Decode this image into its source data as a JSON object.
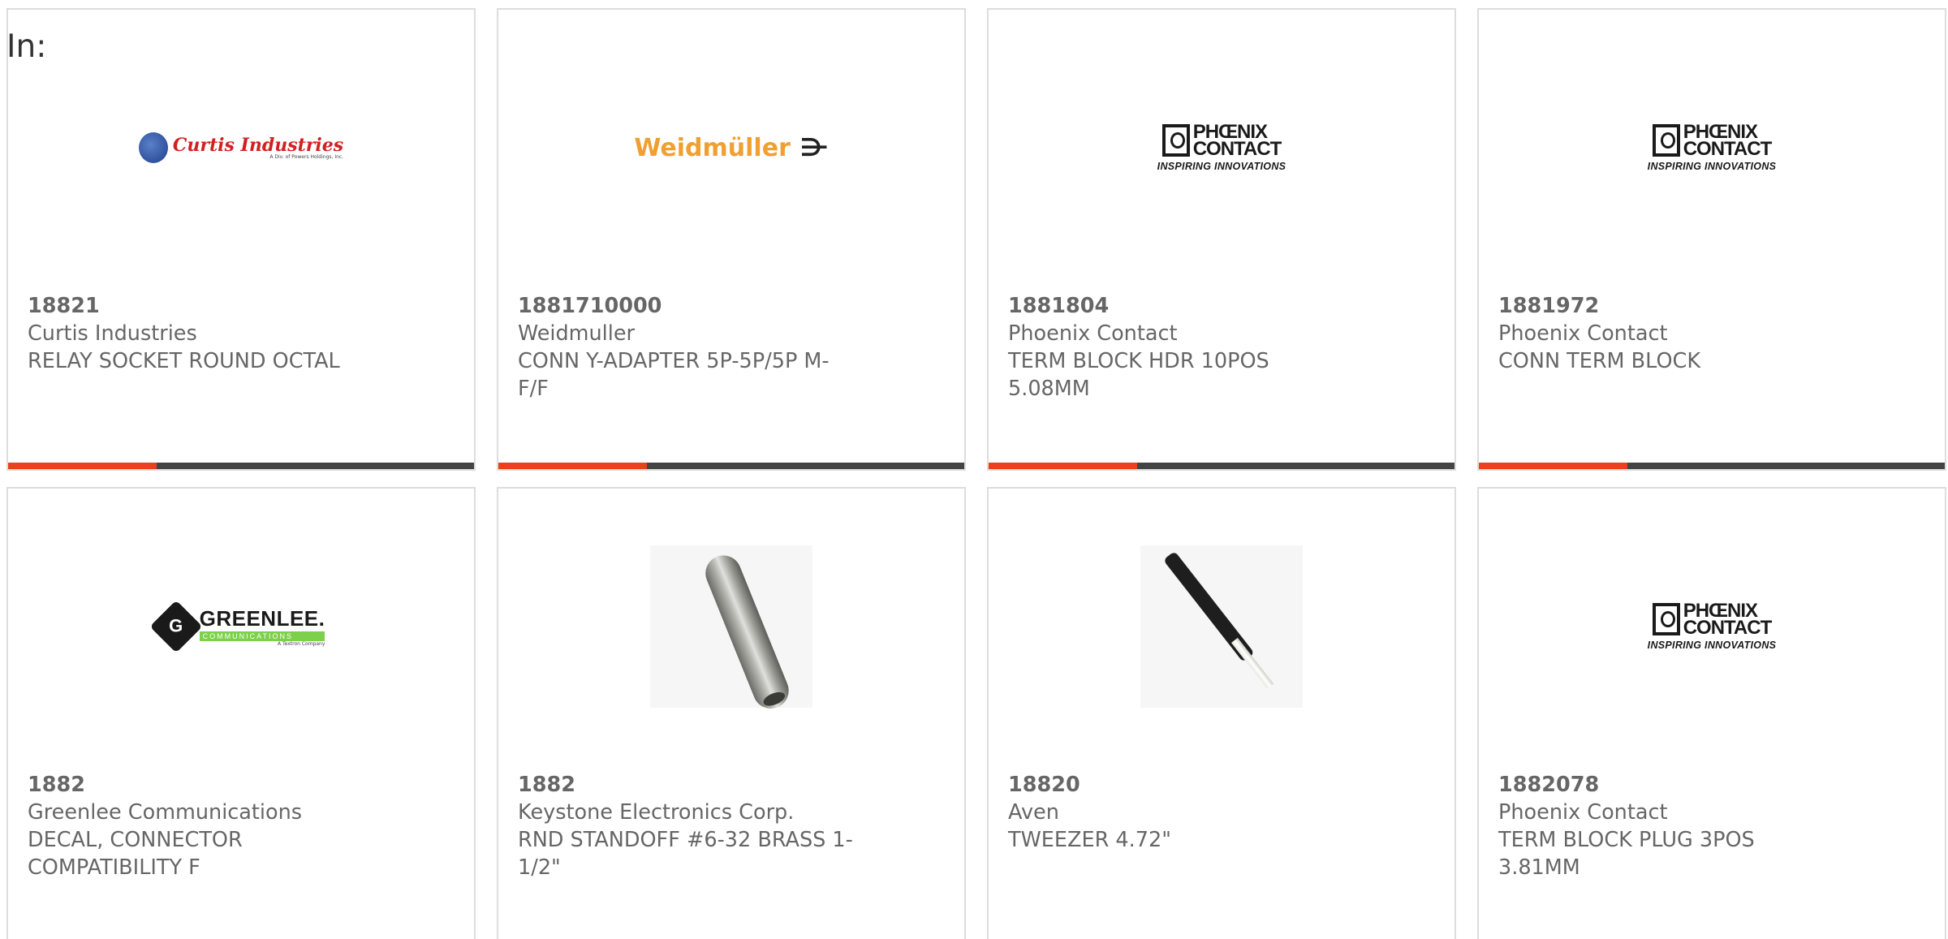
{
  "header": {
    "in_label": "In:"
  },
  "colors": {
    "accent": "#e8411b",
    "bar": "#444444",
    "text": "#666666",
    "border": "#dddddd"
  },
  "products": [
    {
      "logo_name": "Curtis Industries",
      "logo_sub": "A Div. of Powers Holdings, Inc.",
      "part_number": "18821",
      "manufacturer": "Curtis Industries",
      "description": "RELAY SOCKET ROUND OCTAL"
    },
    {
      "logo_name": "Weidmüller",
      "logo_mark": "⋺",
      "part_number": "1881710000",
      "manufacturer": "Weidmuller",
      "description": "CONN Y-ADAPTER 5P-5P/5P M-F/F"
    },
    {
      "logo_line1": "PHŒNIX",
      "logo_line2": "CONTACT",
      "logo_tag": "INSPIRING INNOVATIONS",
      "part_number": "1881804",
      "manufacturer": "Phoenix Contact",
      "description": "TERM BLOCK HDR 10POS 5.08MM"
    },
    {
      "logo_line1": "PHŒNIX",
      "logo_line2": "CONTACT",
      "logo_tag": "INSPIRING INNOVATIONS",
      "part_number": "1881972",
      "manufacturer": "Phoenix Contact",
      "description": "CONN TERM BLOCK"
    },
    {
      "logo_letter": "G",
      "logo_name": "GREENLEE.",
      "logo_sub": "COMMUNICATIONS",
      "logo_tiny": "A Textron Company",
      "part_number": "1882",
      "manufacturer": "Greenlee Communications",
      "description": "DECAL, CONNECTOR COMPATIBILITY F"
    },
    {
      "part_number": "1882",
      "manufacturer": "Keystone Electronics Corp.",
      "description": "RND STANDOFF #6-32 BRASS 1-1/2\""
    },
    {
      "part_number": "18820",
      "manufacturer": "Aven",
      "description": "TWEEZER 4.72\""
    },
    {
      "logo_line1": "PHŒNIX",
      "logo_line2": "CONTACT",
      "logo_tag": "INSPIRING INNOVATIONS",
      "part_number": "1882078",
      "manufacturer": "Phoenix Contact",
      "description": "TERM BLOCK PLUG 3POS 3.81MM"
    }
  ]
}
